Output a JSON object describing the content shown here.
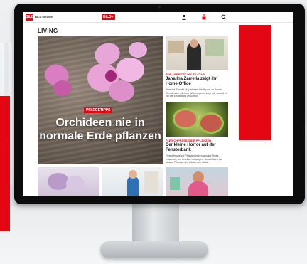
{
  "header": {
    "logo_text": "BILD",
    "brand_label": "BILD MEDIEN",
    "bplus_label": "BILD+",
    "icons": [
      "person-icon",
      "lock-icon",
      "search-icon"
    ]
  },
  "section_title": "LIVING",
  "hero": {
    "kicker": "PFLEGETIPPS",
    "headline": "Orchideen nie in normale Erde pflanzen"
  },
  "side_articles": [
    {
      "kicker": "FÜR ARBEITET DIE TV-STAR",
      "title": "Jana Ina Zarrella zeigt ihr Home-Office",
      "text": "Jana Ina Zarrella (44) arbeitet häufig von zu Hause. Gemeinsam mit einer Wohnexpertin zeigt sie, worauf es bei der Einrichtung ankommt."
    },
    {
      "kicker": "FLEISCHFRESSENDE PFLANZEN",
      "title": "Der kleine Horror auf der Fensterbank",
      "text": "Fleischfressende Pflanzen haben winzige Tricks entwickelt, um Insekten zu fangen. So schützen sie andere Pflanzen und bleiben vor Befall."
    }
  ],
  "colors": {
    "brand_red": "#e30613",
    "bezel": "#0c0c0d",
    "screen_bg": "#ffffff"
  }
}
